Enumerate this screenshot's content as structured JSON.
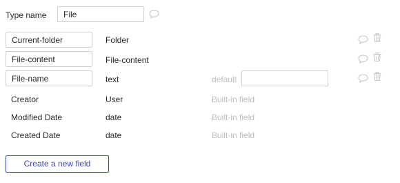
{
  "type_name": {
    "label": "Type name",
    "value": "File"
  },
  "fields": [
    {
      "name": "Current-folder",
      "type": "Folder",
      "editable": true
    },
    {
      "name": "File-content",
      "type": "File-content",
      "editable": true
    },
    {
      "name": "File-name",
      "type": "text",
      "editable": true,
      "default_label": "default",
      "default_value": ""
    }
  ],
  "builtin_fields": [
    {
      "name": "Creator",
      "type": "User",
      "note": "Built-in field"
    },
    {
      "name": "Modified Date",
      "type": "date",
      "note": "Built-in field"
    },
    {
      "name": "Created Date",
      "type": "date",
      "note": "Built-in field"
    }
  ],
  "create_button_label": "Create a new field",
  "icons": {
    "comment": "comment-icon",
    "delete": "trash-icon"
  },
  "colors": {
    "accent": "#3a4bb0",
    "muted_text": "#bdbdbd",
    "icon": "#c4c8cc"
  }
}
